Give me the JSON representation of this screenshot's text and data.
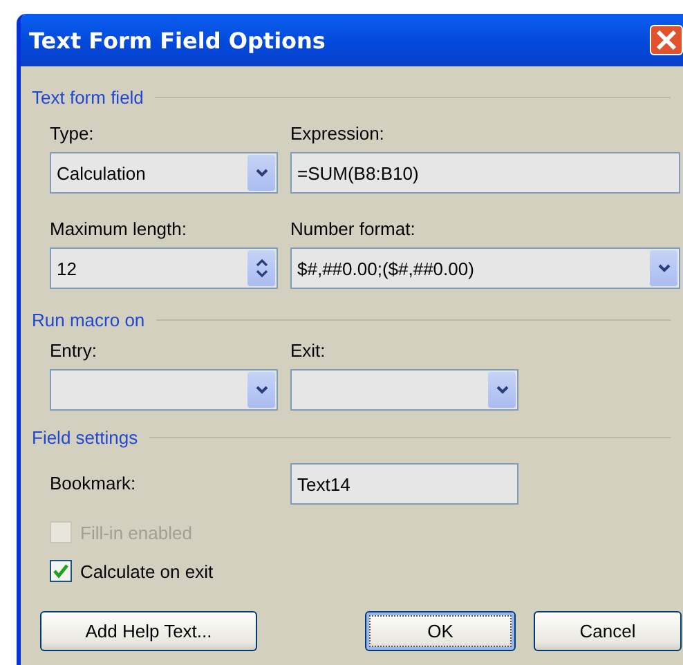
{
  "window": {
    "title": "Text Form Field Options"
  },
  "text_form_field": {
    "heading": "Text form field",
    "type": {
      "label": "Type:",
      "value": "Calculation"
    },
    "expression": {
      "label": "Expression:",
      "value": "=SUM(B8:B10)"
    },
    "maximum_length": {
      "label": "Maximum length:",
      "value": "12"
    },
    "number_format": {
      "label": "Number format:",
      "value": "$#,##0.00;($#,##0.00)"
    }
  },
  "run_macro_on": {
    "heading": "Run macro on",
    "entry": {
      "label": "Entry:"
    },
    "exit": {
      "label": "Exit:"
    }
  },
  "field_settings": {
    "heading": "Field settings",
    "bookmark": {
      "label": "Bookmark:",
      "value": "Text14"
    },
    "options": [
      {
        "label": "Fill-in enabled",
        "checked": false,
        "disabled": true
      },
      {
        "label": "Calculate on exit",
        "checked": true,
        "disabled": false
      }
    ]
  },
  "buttons": [
    {
      "label": "Add Help Text...",
      "default": false
    },
    {
      "label": "OK",
      "default": true
    },
    {
      "label": "Cancel",
      "default": false
    }
  ]
}
